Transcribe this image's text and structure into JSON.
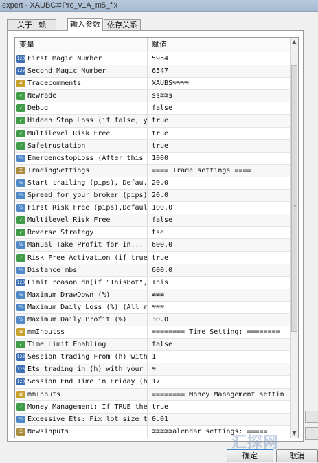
{
  "window": {
    "title": "expert - XAUBC⁠≋Pro_v1A_m5_fix"
  },
  "tabs": [
    {
      "label": "关于 ⁠ ⁠ 赖"
    },
    {
      "label": "输入参数"
    },
    {
      "label": "依存关系"
    }
  ],
  "grid": {
    "headers": {
      "variable": "变量",
      "value": "赋值"
    },
    "rows": [
      {
        "type": "num",
        "icon": "123",
        "name": "First Magic Number",
        "value": "5954"
      },
      {
        "type": "num",
        "icon": "123",
        "name": "Second Magic Number",
        "value": "6547"
      },
      {
        "type": "txt",
        "icon": "ab",
        "name": "Tradecomments",
        "value": "XAUBS≋≋≋≋"
      },
      {
        "type": "bool",
        "icon": "✓",
        "name": "Newrade",
        "value": "ss≋≋s"
      },
      {
        "type": "bool",
        "icon": "✓",
        "name": "Debug",
        "value": "false"
      },
      {
        "type": "bool",
        "icon": "✓",
        "name": "Hidden Stop Loss (if false, y...",
        "value": "true"
      },
      {
        "type": "bool",
        "icon": "✓",
        "name": "Multilevel Risk Free",
        "value": "true"
      },
      {
        "type": "bool",
        "icon": "✓",
        "name": "Safetrustation",
        "value": "true"
      },
      {
        "type": "dbl",
        "icon": "½",
        "name": "EmergencstopLoss (After this p...",
        "value": "1000"
      },
      {
        "type": "date",
        "icon": "☷",
        "name": "TradingSettings",
        "value": "==== Trade settings ===="
      },
      {
        "type": "dbl",
        "icon": "½",
        "name": "Start trailing (pips), Defau...",
        "value": "20.0"
      },
      {
        "type": "dbl",
        "icon": "½",
        "name": "Spread for your broker (pips)...",
        "value": "20.0"
      },
      {
        "type": "dbl",
        "icon": "½",
        "name": "First Risk Free (pips),Defaul...",
        "value": "100.0"
      },
      {
        "type": "bool",
        "icon": "✓",
        "name": "Multilevel Risk Free",
        "value": "false"
      },
      {
        "type": "bool",
        "icon": "✓",
        "name": "Reverse Strategy",
        "value": "tse"
      },
      {
        "type": "dbl",
        "icon": "½",
        "name": "Manual Take Profit for in...",
        "value": "600.0"
      },
      {
        "type": "bool",
        "icon": "✓",
        "name": "Risk Free Activation (if true...",
        "value": "true"
      },
      {
        "type": "dbl",
        "icon": "½",
        "name": "Distance mbs",
        "value": "600.0"
      },
      {
        "type": "num",
        "icon": "123",
        "name": "Limit reason dn(if \"ThisBot\", ...",
        "value": "This"
      },
      {
        "type": "dbl",
        "icon": "½",
        "name": "Maximum DrawDown (%)",
        "value": "≋≋≋"
      },
      {
        "type": "dbl",
        "icon": "½",
        "name": "Maximum Daily Loss (%) (All r...",
        "value": "≋≋≋"
      },
      {
        "type": "dbl",
        "icon": "½",
        "name": "Maximum Daily Profit (%)",
        "value": "30.0"
      },
      {
        "type": "txt",
        "icon": "ab",
        "name": "mmInputss",
        "value": "======== Time Setting: ========"
      },
      {
        "type": "bool",
        "icon": "✓",
        "name": "Time Limit Enabling",
        "value": "false"
      },
      {
        "type": "num",
        "icon": "123",
        "name": "Session trading From (h) with y...",
        "value": "1"
      },
      {
        "type": "num",
        "icon": "123",
        "name": "Ets trading in (h) with your ...",
        "value": "≋"
      },
      {
        "type": "num",
        "icon": "123",
        "name": "Session End Time in Friday (h...",
        "value": "17"
      },
      {
        "type": "txt",
        "icon": "ab",
        "name": "mmInputs",
        "value": "======== Money Management settin..."
      },
      {
        "type": "bool",
        "icon": "✓",
        "name": "Money Management: If TRUE the...",
        "value": "true"
      },
      {
        "type": "dbl",
        "icon": "½",
        "name": "Excessive Ets: Fix lot size t...",
        "value": "0.01"
      },
      {
        "type": "date",
        "icon": "☷",
        "name": "Newsinputs",
        "value": "≋≋≋≋≋alendar settings: ====="
      }
    ]
  },
  "buttons": {
    "ok": "确定",
    "cancel": "取消"
  },
  "watermark": "汇探网",
  "colors": {
    "selection": "#3b80c6",
    "int_icon": "#3c6fb4",
    "text_icon": "#c9a22e",
    "bool_icon": "#3f9d4a"
  }
}
